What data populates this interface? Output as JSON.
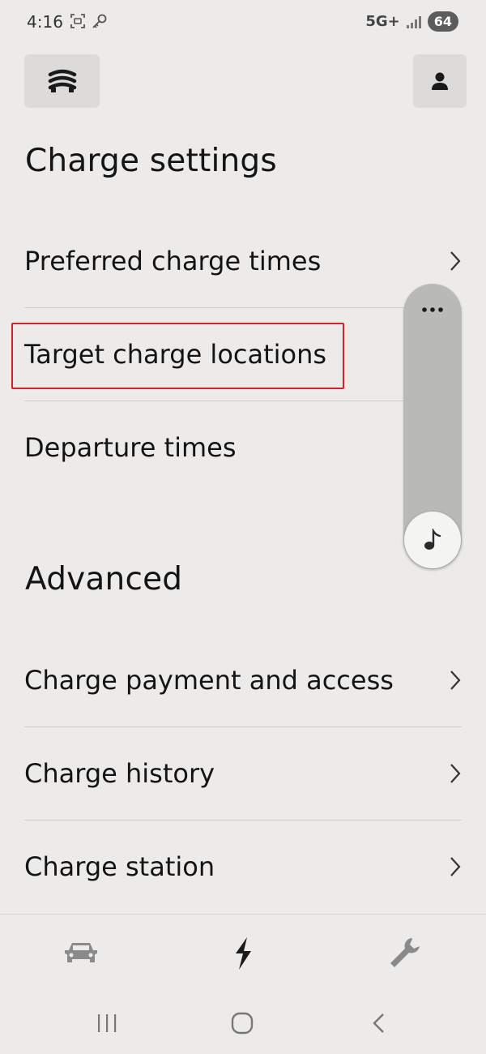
{
  "status_bar": {
    "time": "4:16",
    "network": "5G+",
    "battery": "64"
  },
  "header": {
    "menu_icon": "layers-stack-icon",
    "profile_icon": "person-icon"
  },
  "charge_settings": {
    "title": "Charge settings",
    "items": [
      {
        "label": "Preferred charge times",
        "chevron": true
      },
      {
        "label": "Target charge locations",
        "chevron": false,
        "highlighted": true
      },
      {
        "label": "Departure times",
        "chevron": false
      }
    ]
  },
  "advanced": {
    "title": "Advanced",
    "items": [
      {
        "label": "Charge payment and access",
        "chevron": true
      },
      {
        "label": "Charge history",
        "chevron": true
      },
      {
        "label": "Charge station",
        "chevron": true
      }
    ]
  },
  "floating_panel": {
    "top_icon": "more-horizontal-icon",
    "bottom_icon": "music-note-icon"
  },
  "bottom_nav": {
    "items": [
      {
        "icon": "car-icon",
        "active": false
      },
      {
        "icon": "lightning-icon",
        "active": true
      },
      {
        "icon": "wrench-icon",
        "active": false
      }
    ]
  },
  "colors": {
    "background": "#ecebea",
    "highlight": "#d0232b",
    "text": "#141414"
  }
}
